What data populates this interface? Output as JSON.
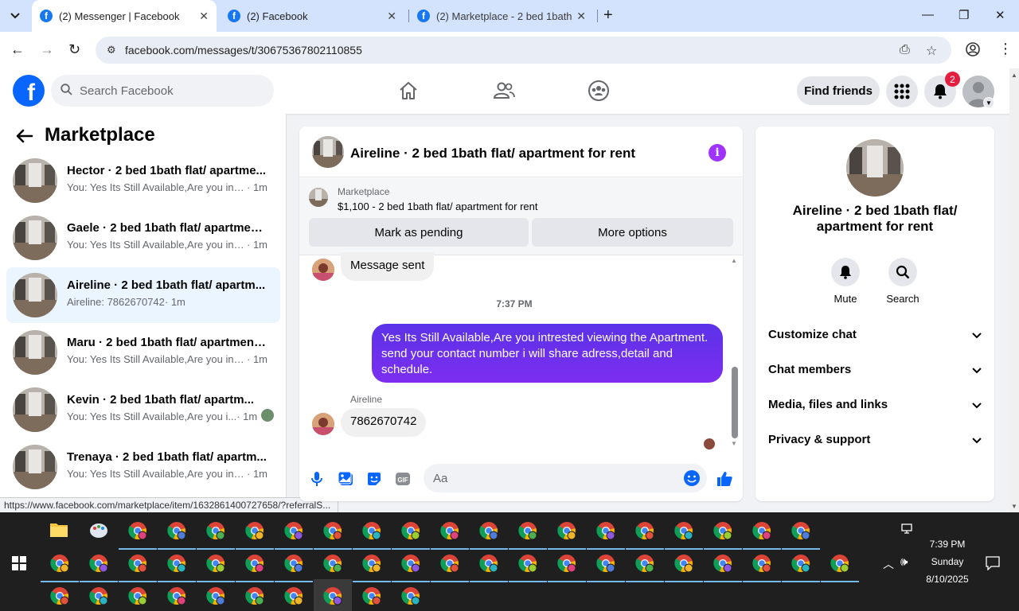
{
  "browser": {
    "tabs": [
      {
        "title": "(2) Messenger | Facebook",
        "active": true
      },
      {
        "title": "(2) Facebook",
        "active": false
      },
      {
        "title": "(2) Marketplace - 2 bed 1bath fl",
        "active": false
      }
    ],
    "url": "facebook.com/messages/t/30675367802110855",
    "status_url": "https://www.facebook.com/marketplace/item/1632861400727658/?referralS..."
  },
  "fbnav": {
    "search_placeholder": "Search Facebook",
    "find_friends": "Find friends",
    "notification_count": "2"
  },
  "sidebar": {
    "title": "Marketplace",
    "conversations": [
      {
        "name": "Hector · 2 bed 1bath flat/ apartme...",
        "preview": "You: Yes Its Still Available,Are you intr...",
        "time": " · 1m",
        "active": false
      },
      {
        "name": "Gaele · 2 bed 1bath flat/ apartmen...",
        "preview": "You: Yes Its Still Available,Are you intr...",
        "time": " · 1m",
        "active": false
      },
      {
        "name": "Aireline · 2 bed 1bath flat/ apartm...",
        "preview": "Aireline: 7862670742",
        "time": " · 1m",
        "active": true
      },
      {
        "name": "Maru · 2 bed 1bath flat/ apartment...",
        "preview": "You: Yes Its Still Available,Are you intr...",
        "time": " · 1m",
        "active": false
      },
      {
        "name": "Kevin · 2 bed 1bath flat/ apartm...",
        "preview": "You: Yes Its Still Available,Are you i...",
        "time": " · 1m",
        "active": false
      },
      {
        "name": "Trenaya · 2 bed 1bath flat/ apartm...",
        "preview": "You: Yes Its Still Available,Are you intr...",
        "time": " · 1m",
        "active": false
      }
    ]
  },
  "chat": {
    "title": "Aireline · 2 bed 1bath flat/ apartment for rent",
    "listing_label": "Marketplace",
    "listing_price": "$1,100 - 2 bed 1bath flat/ apartment for rent",
    "mark_pending": "Mark as pending",
    "more_options": "More options",
    "msg_sent": "Message sent",
    "timestamp": "7:37 PM",
    "outgoing": "Yes Its Still Available,Are you intrested viewing the Apartment. send your contact number i will share adress,detail and schedule.",
    "sender": "Aireline",
    "incoming": "7862670742",
    "input_placeholder": "Aa"
  },
  "info": {
    "title": "Aireline · 2 bed 1bath flat/ apartment for rent",
    "mute": "Mute",
    "search": "Search",
    "sections": [
      "Customize chat",
      "Chat members",
      "Media, files and links",
      "Privacy & support"
    ]
  },
  "taskbar": {
    "time": "7:39 PM",
    "day": "Sunday",
    "date": "8/10/2025"
  },
  "colors": {
    "fb_blue": "#0866ff",
    "bubble_purple": "#6a2cf0",
    "active_conv": "#ebf5ff",
    "badge_red": "#e41e3f"
  }
}
